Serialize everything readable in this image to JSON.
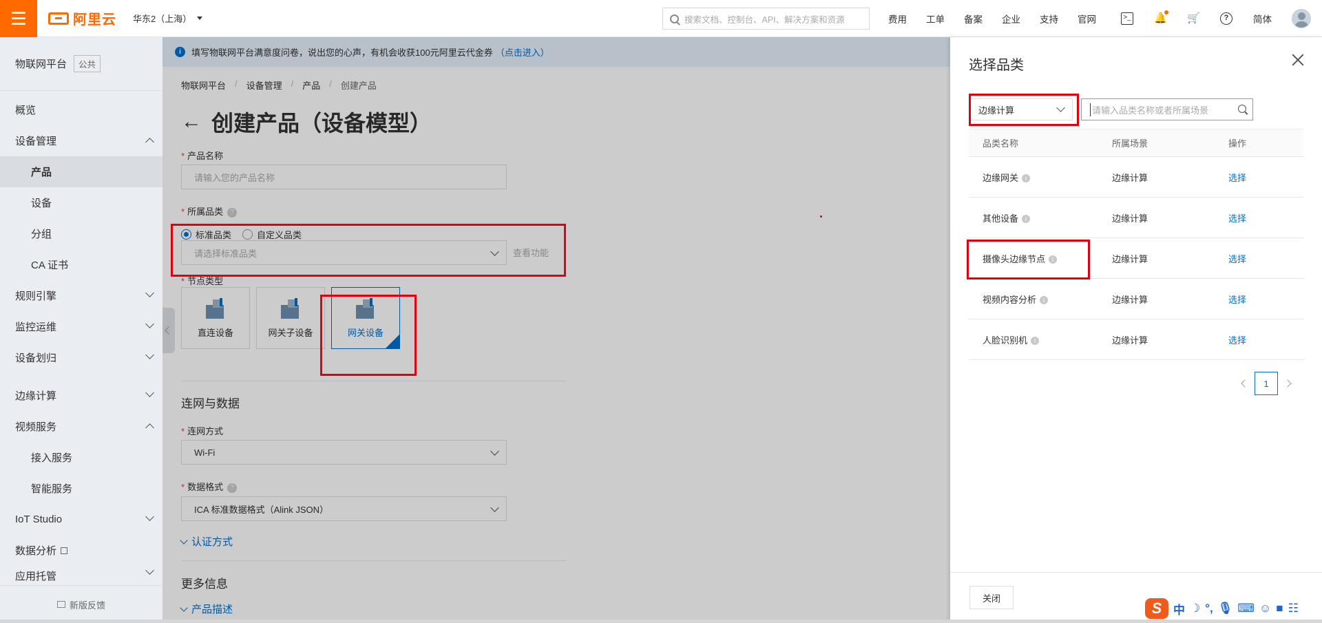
{
  "topbar": {
    "logo_text": "阿里云",
    "region": "华东2（上海）",
    "search_placeholder": "搜索文档、控制台、API、解决方案和资源",
    "links": [
      "费用",
      "工单",
      "备案",
      "企业",
      "支持",
      "官网"
    ],
    "lang": "简体"
  },
  "sidebar": {
    "title": "物联网平台",
    "tag": "公共",
    "items": [
      {
        "label": "概览"
      },
      {
        "label": "设备管理"
      },
      {
        "label": "产品"
      },
      {
        "label": "设备"
      },
      {
        "label": "分组"
      },
      {
        "label": "CA 证书"
      },
      {
        "label": "规则引擎"
      },
      {
        "label": "监控运维"
      },
      {
        "label": "设备划归"
      },
      {
        "label": "边缘计算"
      },
      {
        "label": "视频服务"
      },
      {
        "label": "接入服务"
      },
      {
        "label": "智能服务"
      },
      {
        "label": "IoT Studio"
      },
      {
        "label": "数据分析"
      },
      {
        "label": "应用托管"
      }
    ],
    "feedback": "新版反馈"
  },
  "main": {
    "banner_text": "填写物联网平台满意度问卷，说出您的心声，有机会收获100元阿里云代金券",
    "banner_link": "（点击进入）",
    "breadcrumb": [
      "物联网平台",
      "设备管理",
      "产品",
      "创建产品"
    ],
    "title": "创建产品（设备模型）",
    "product_name_label": "产品名称",
    "product_name_placeholder": "请输入您的产品名称",
    "category_label": "所属品类",
    "radio_standard": "标准品类",
    "radio_custom": "自定义品类",
    "category_placeholder": "请选择标准品类",
    "view_function": "查看功能",
    "node_type_label": "节点类型",
    "nodes": [
      {
        "label": "直连设备"
      },
      {
        "label": "网关子设备"
      },
      {
        "label": "网关设备"
      }
    ],
    "network_section": "连网与数据",
    "network_label": "连网方式",
    "network_value": "Wi-Fi",
    "data_format_label": "数据格式",
    "data_format_value": "ICA 标准数据格式（Alink JSON）",
    "auth_expander": "认证方式",
    "more_info_section": "更多信息",
    "desc_expander": "产品描述"
  },
  "drawer": {
    "title": "选择品类",
    "filter_value": "边缘计算",
    "search_placeholder": "请输入品类名称或者所属场景",
    "columns": [
      "品类名称",
      "所属场景",
      "操作"
    ],
    "rows": [
      {
        "name": "边缘网关",
        "scene": "边缘计算",
        "action": "选择"
      },
      {
        "name": "其他设备",
        "scene": "边缘计算",
        "action": "选择"
      },
      {
        "name": "摄像头边缘节点",
        "scene": "边缘计算",
        "action": "选择"
      },
      {
        "name": "视频内容分析",
        "scene": "边缘计算",
        "action": "选择"
      },
      {
        "name": "人脸识别机",
        "scene": "边缘计算",
        "action": "选择"
      }
    ],
    "page_current": "1",
    "close_button": "关闭"
  },
  "ime": {
    "chars": [
      "中",
      "☽",
      "°,",
      "🎙",
      "⌨",
      "☺",
      "■",
      "☷"
    ]
  },
  "colors": {
    "brand": "#ff6a00",
    "link": "#0070cc",
    "highlight": "#e0000f"
  }
}
